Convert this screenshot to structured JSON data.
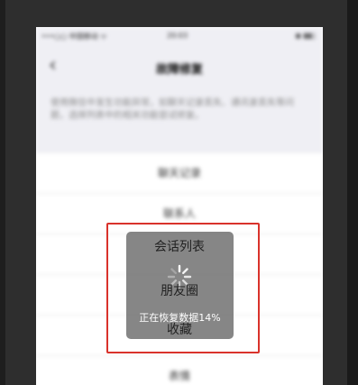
{
  "status_bar": {
    "carrier": "•••○○ 中国移动 ᯤ",
    "time": "20:03",
    "battery": "◉ ▮▮▯"
  },
  "nav": {
    "back_icon": "chevron-left",
    "title": "故障修复"
  },
  "description": "使用微信中发生功能异常，如聊天记录丢失、通讯录丢失等问题，选择列表中的相关功能尝试修复。",
  "list_items": [
    {
      "label": "聊天记录"
    },
    {
      "label": "联系人"
    },
    {
      "label": "会话列表"
    },
    {
      "label": "朋友圈"
    },
    {
      "label": "收藏"
    },
    {
      "label": "表情"
    }
  ],
  "hud": {
    "icon": "loading-spinner-icon",
    "progress_text": "正在恢复数据14%",
    "progress_percent": 14
  },
  "highlight_color": "#d9322b"
}
